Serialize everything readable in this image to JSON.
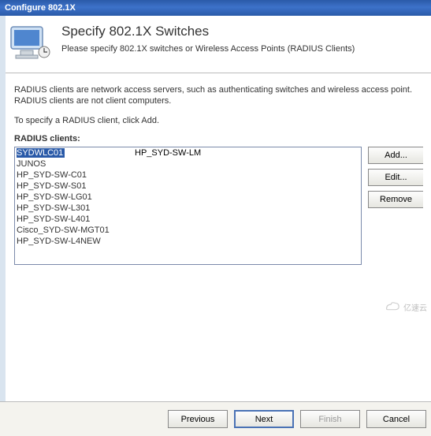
{
  "window": {
    "title": "Configure 802.1X"
  },
  "header": {
    "heading": "Specify 802.1X Switches",
    "subheading": "Please specify 802.1X switches or Wireless Access Points (RADIUS Clients)"
  },
  "body": {
    "intro1": "RADIUS clients are network access servers, such as authenticating switches and wireless access point. RADIUS clients are not client computers.",
    "intro2": "To specify a RADIUS client, click Add.",
    "list_label": "RADIUS clients:"
  },
  "clients": [
    {
      "name": "SYDWLC01",
      "desc": "HP_SYD-SW-LM",
      "selected": true
    },
    {
      "name": "JUNOS",
      "desc": ""
    },
    {
      "name": "HP_SYD-SW-C01",
      "desc": ""
    },
    {
      "name": "HP_SYD-SW-S01",
      "desc": ""
    },
    {
      "name": "HP_SYD-SW-LG01",
      "desc": ""
    },
    {
      "name": "HP_SYD-SW-L301",
      "desc": ""
    },
    {
      "name": "HP_SYD-SW-L401",
      "desc": ""
    },
    {
      "name": "Cisco_SYD-SW-MGT01",
      "desc": ""
    },
    {
      "name": "HP_SYD-SW-L4NEW",
      "desc": ""
    }
  ],
  "side_buttons": {
    "add": "Add...",
    "edit": "Edit...",
    "remove": "Remove"
  },
  "footer": {
    "previous": "Previous",
    "next": "Next",
    "finish": "Finish",
    "cancel": "Cancel"
  },
  "watermark": "亿速云"
}
